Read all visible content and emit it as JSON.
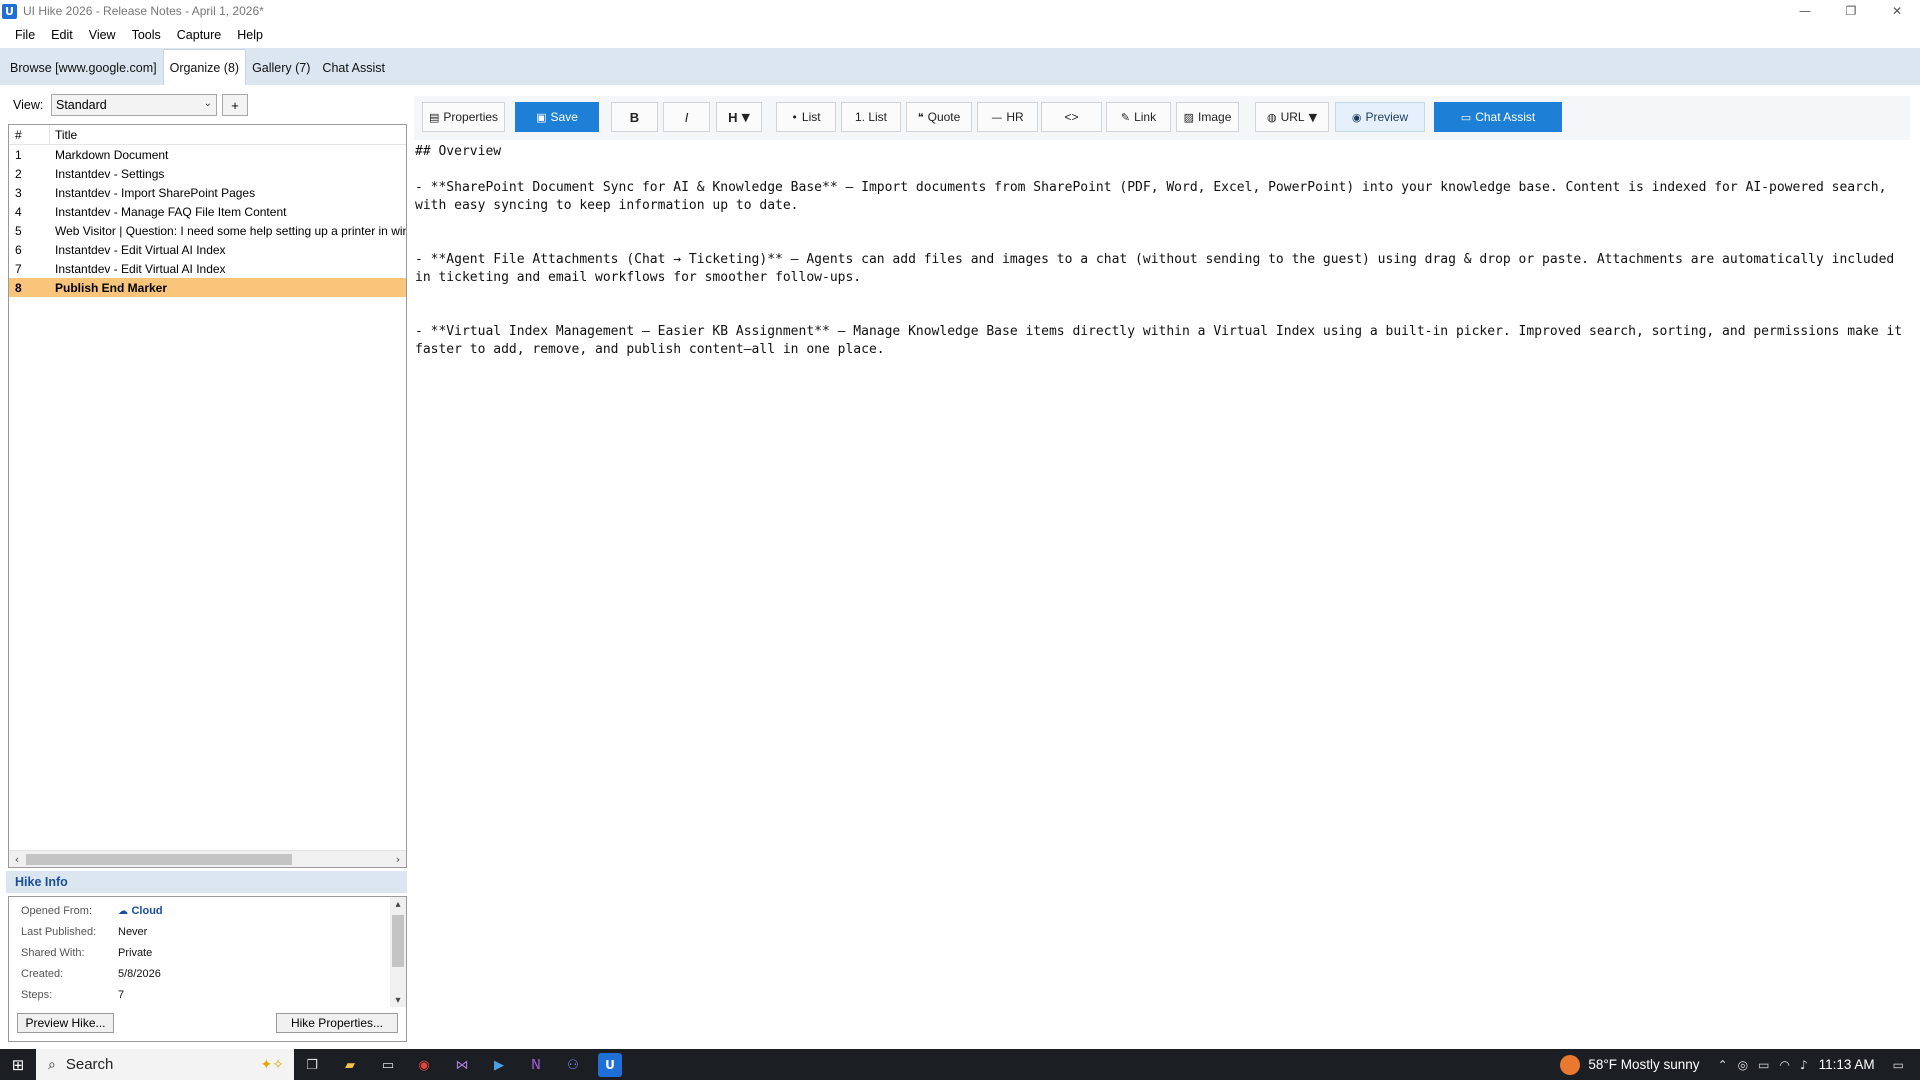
{
  "window": {
    "title": "UI Hike 2026 - Release Notes - April 1, 2026*",
    "app_icon_letter": "U"
  },
  "menu": [
    "File",
    "Edit",
    "View",
    "Tools",
    "Capture",
    "Help"
  ],
  "tabs": [
    {
      "label": "Browse [www.google.com]",
      "active": false
    },
    {
      "label": "Organize (8)",
      "active": true
    },
    {
      "label": "Gallery (7)",
      "active": false
    },
    {
      "label": "Chat Assist",
      "active": false
    }
  ],
  "left_panel": {
    "view_label": "View:",
    "view_value": "Standard",
    "add_label": "+",
    "columns": {
      "num": "#",
      "title": "Title"
    },
    "rows": [
      {
        "num": "1",
        "title": "Markdown Document"
      },
      {
        "num": "2",
        "title": "Instantdev - Settings"
      },
      {
        "num": "3",
        "title": "Instantdev - Import SharePoint Pages"
      },
      {
        "num": "4",
        "title": "Instantdev - Manage FAQ File Item Content"
      },
      {
        "num": "5",
        "title": "Web Visitor | Question: I need some help setting up a printer in win"
      },
      {
        "num": "6",
        "title": "Instantdev - Edit Virtual AI Index"
      },
      {
        "num": "7",
        "title": "Instantdev - Edit Virtual AI Index"
      },
      {
        "num": "8",
        "title": "Publish End Marker"
      }
    ],
    "selected_index": 7
  },
  "hike_info": {
    "title": "Hike Info",
    "opened_from_key": "Opened From:",
    "opened_from_val": "Cloud",
    "last_published_key": "Last Published:",
    "last_published_val": "Never",
    "shared_with_key": "Shared With:",
    "shared_with_val": "Private",
    "created_key": "Created:",
    "created_val": "5/8/2026",
    "steps_key": "Steps:",
    "steps_val": "7",
    "preview_button": "Preview Hike...",
    "properties_button": "Hike Properties..."
  },
  "toolbar": {
    "properties": "Properties",
    "save": "Save",
    "bold": "B",
    "italic": "I",
    "heading": "H",
    "bullet_list": "List",
    "numbered_list": "1. List",
    "quote": "Quote",
    "hr": "HR",
    "code": "<>",
    "link": "Link",
    "image": "Image",
    "url": "URL",
    "preview": "Preview",
    "chat_assist": "Chat Assist"
  },
  "editor": {
    "heading": "## Overview",
    "para1": "- **SharePoint Document Sync for AI & Knowledge Base** – Import documents from SharePoint (PDF, Word, Excel, PowerPoint) into your knowledge base. Content is indexed for AI-powered search, with easy syncing to keep information up to date.",
    "para2": "- **Agent File Attachments (Chat → Ticketing)** – Agents can add files and images to a chat (without sending to the guest) using drag & drop or paste. Attachments are automatically included in ticketing and email workflows for smoother follow-ups.",
    "para3": "- **Virtual Index Management – Easier KB Assignment** – Manage Knowledge Base items directly within a Virtual Index using a built-in picker. Improved search, sorting, and permissions make it faster to add, remove, and publish content—all in one place."
  },
  "taskbar": {
    "search_label": "Search",
    "weather": "58°F  Mostly sunny",
    "time": "11:13 AM"
  },
  "colors": {
    "accent": "#1e7fd6",
    "selected_row": "#f8c57a",
    "tab_bar": "#dce6f0",
    "taskbar": "#1b1f24"
  }
}
